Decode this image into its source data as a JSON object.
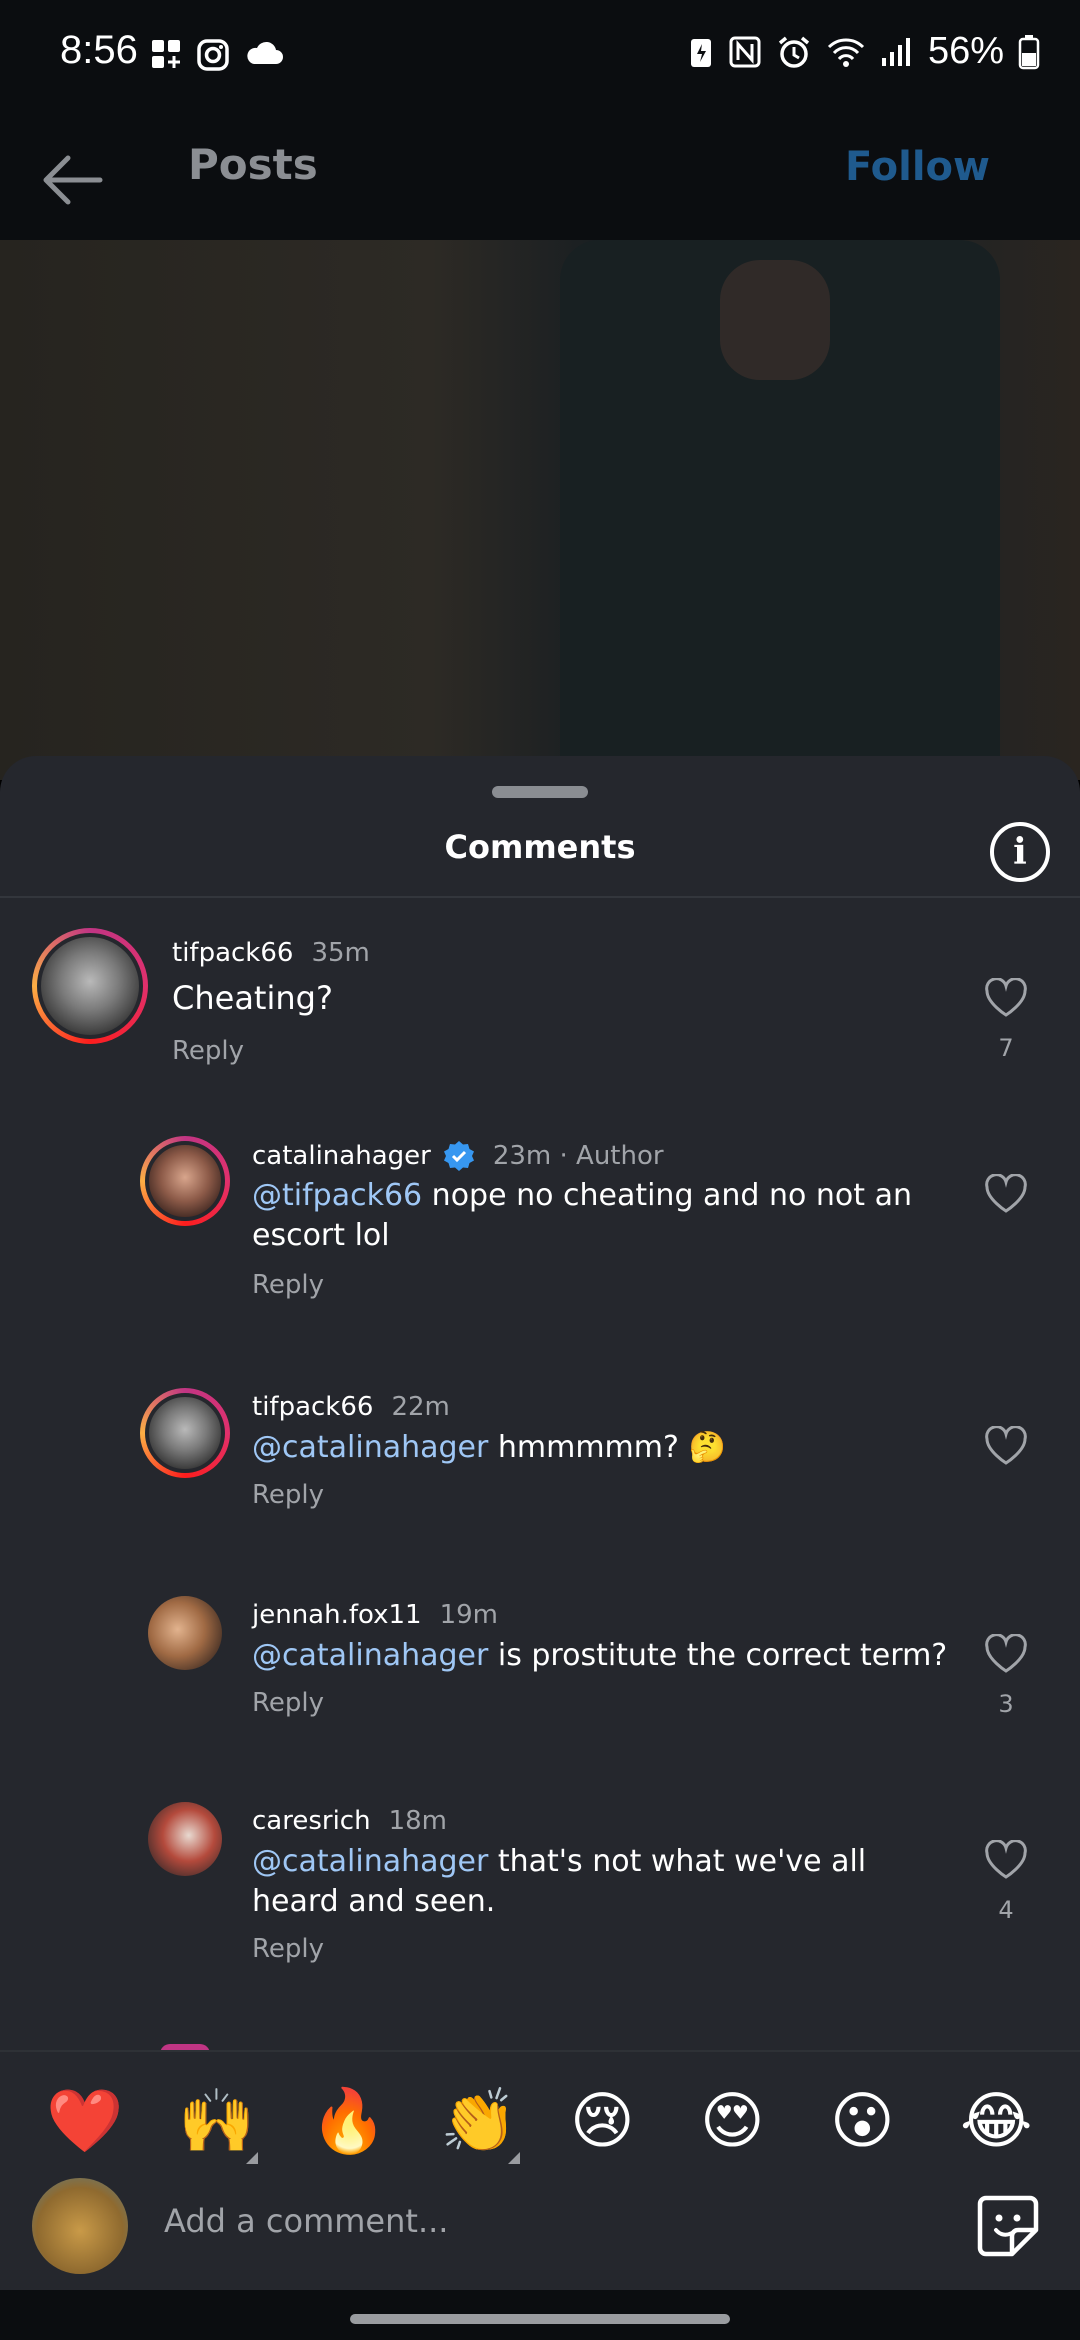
{
  "status_bar": {
    "time": "8:56",
    "battery": "56%"
  },
  "app_bar": {
    "title": "Posts",
    "follow_label": "Follow"
  },
  "sheet": {
    "title": "Comments"
  },
  "comments": [
    {
      "username": "tifpack66",
      "time": "35m",
      "text": "Cheating?",
      "reply": "Reply",
      "likes": "7"
    },
    {
      "username": "catalinahager",
      "time": "23m · Author",
      "mention": "@tifpack66",
      "text": " nope no cheating and no not an escort lol",
      "reply": "Reply",
      "likes": ""
    },
    {
      "username": "tifpack66",
      "time": "22m",
      "mention": "@catalinahager",
      "text": " hmmmmm? 🤔",
      "reply": "Reply",
      "likes": ""
    },
    {
      "username": "jennah.fox11",
      "time": "19m",
      "mention": "@catalinahager",
      "text": " is prostitute the correct term?",
      "reply": "Reply",
      "likes": "3"
    },
    {
      "username": "caresrich",
      "time": "18m",
      "mention": "@catalinahager",
      "text": " that's not what we've all heard and seen.",
      "reply": "Reply",
      "likes": "4"
    }
  ],
  "emoji_bar": [
    "❤️",
    "🙌",
    "🔥",
    "👏",
    "😢",
    "😍",
    "😮",
    "😂"
  ],
  "composer": {
    "placeholder": "Add a comment..."
  },
  "colors": {
    "sheet_bg": "#25272d",
    "mention": "#9fc7f5",
    "follow": "#1f5a8e",
    "verified": "#3797f0"
  }
}
